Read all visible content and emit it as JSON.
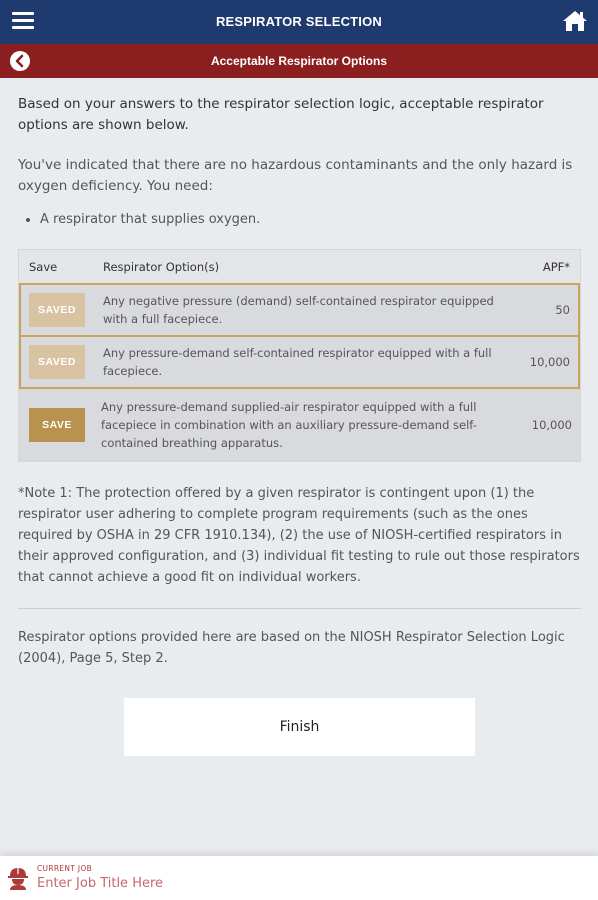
{
  "header": {
    "title": "RESPIRATOR SELECTION"
  },
  "subheader": {
    "title": "Acceptable Respirator Options"
  },
  "intro": "Based on your answers to the respirator selection logic, acceptable respirator options are shown below.",
  "hazard_text": "You've indicated that there are no hazardous contaminants and the only hazard is oxygen deficiency. You need:",
  "requirements": [
    "A respirator that supplies oxygen."
  ],
  "table": {
    "headers": {
      "save": "Save",
      "option": "Respirator Option(s)",
      "apf": "APF*"
    },
    "rows": [
      {
        "button": "SAVED",
        "option": "Any negative pressure (demand) self-contained respirator equipped with a full facepiece.",
        "apf": "50"
      },
      {
        "button": "SAVED",
        "option": "Any pressure-demand self-contained respirator equipped with a full facepiece.",
        "apf": "10,000"
      },
      {
        "button": "SAVE",
        "option": "Any pressure-demand supplied-air respirator equipped with a full facepiece in combination with an auxiliary pressure-demand self-contained breathing apparatus.",
        "apf": "10,000"
      }
    ]
  },
  "note": "*Note 1: The protection offered by a given respirator is contingent upon (1) the respirator user adhering to complete program requirements (such as the ones required by OSHA in 29 CFR 1910.134), (2) the use of NIOSH-certified respirators in their approved configuration, and (3) individual fit testing to rule out those respirators that cannot achieve a good fit on individual workers.",
  "source": "Respirator options provided here are based on the NIOSH Respirator Selection Logic (2004), Page 5, Step 2.",
  "finish_label": "Finish",
  "footer": {
    "label": "CURRENT JOB",
    "placeholder": "Enter Job Title Here"
  },
  "colors": {
    "header": "#1f3a6e",
    "subheader": "#8b1f1f",
    "saved_border": "#c9a45c",
    "save_button": "#b8924e",
    "saved_button": "#d8c4a2"
  }
}
